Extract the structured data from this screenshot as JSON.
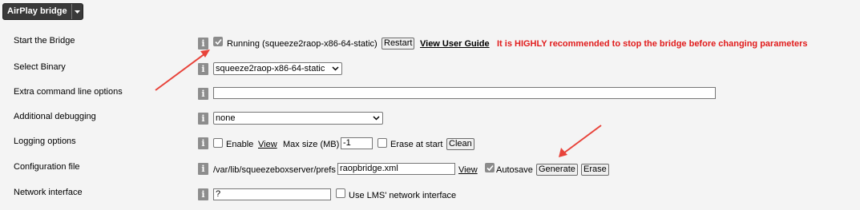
{
  "header": {
    "section_label": "AirPlay bridge"
  },
  "rows": {
    "start": {
      "label": "Start the Bridge",
      "status": "Running (squeeze2raop-x86-64-static)",
      "restart": "Restart",
      "guide": "View User Guide",
      "warning": "It is HIGHLY recommended to stop the bridge before changing parameters",
      "checked": true
    },
    "binary": {
      "label": "Select Binary",
      "value": "squeeze2raop-x86-64-static"
    },
    "extra": {
      "label": "Extra command line options",
      "value": ""
    },
    "debug": {
      "label": "Additional debugging",
      "value": "none"
    },
    "logging": {
      "label": "Logging options",
      "enable": "Enable",
      "view": "View",
      "max_label": "Max size (MB)",
      "max_value": "-1",
      "erase": "Erase at start",
      "clean": "Clean"
    },
    "config": {
      "label": "Configuration file",
      "path": "/var/lib/squeezeboxserver/prefs",
      "file": "raopbridge.xml",
      "view": "View",
      "autosave": "Autosave",
      "generate": "Generate",
      "erase": "Erase"
    },
    "network": {
      "label": "Network interface",
      "value": "?",
      "use_lms": "Use LMS' network interface"
    }
  },
  "colors": {
    "warning": "#e11b1b",
    "arrow": "#e8433a",
    "info_bg": "#8d8d8d",
    "header_bg": "#3a3a3a"
  },
  "icons": {
    "info": "i",
    "section_dropdown": "caret-down-icon",
    "checkbox_check": "check-icon"
  }
}
